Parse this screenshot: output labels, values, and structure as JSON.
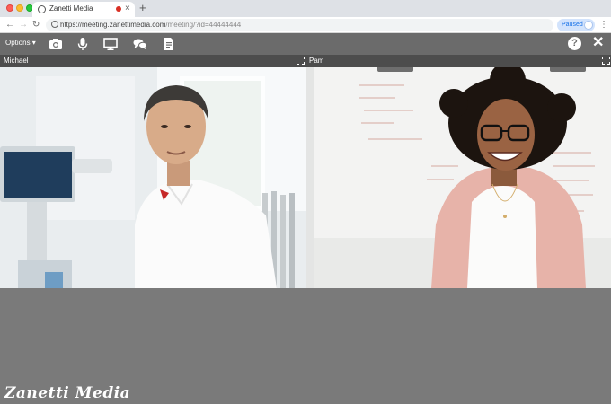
{
  "browser": {
    "tab_title": "Zanetti Media",
    "url_host": "https://meeting.zanettimedia.com",
    "url_path": "/meeting/?id=44444444",
    "profile_status": "Paused"
  },
  "controls": {
    "options_label": "Options ▾"
  },
  "participants": [
    {
      "name": "Michael"
    },
    {
      "name": "Pam"
    }
  ],
  "branding": "Zanetti Media"
}
